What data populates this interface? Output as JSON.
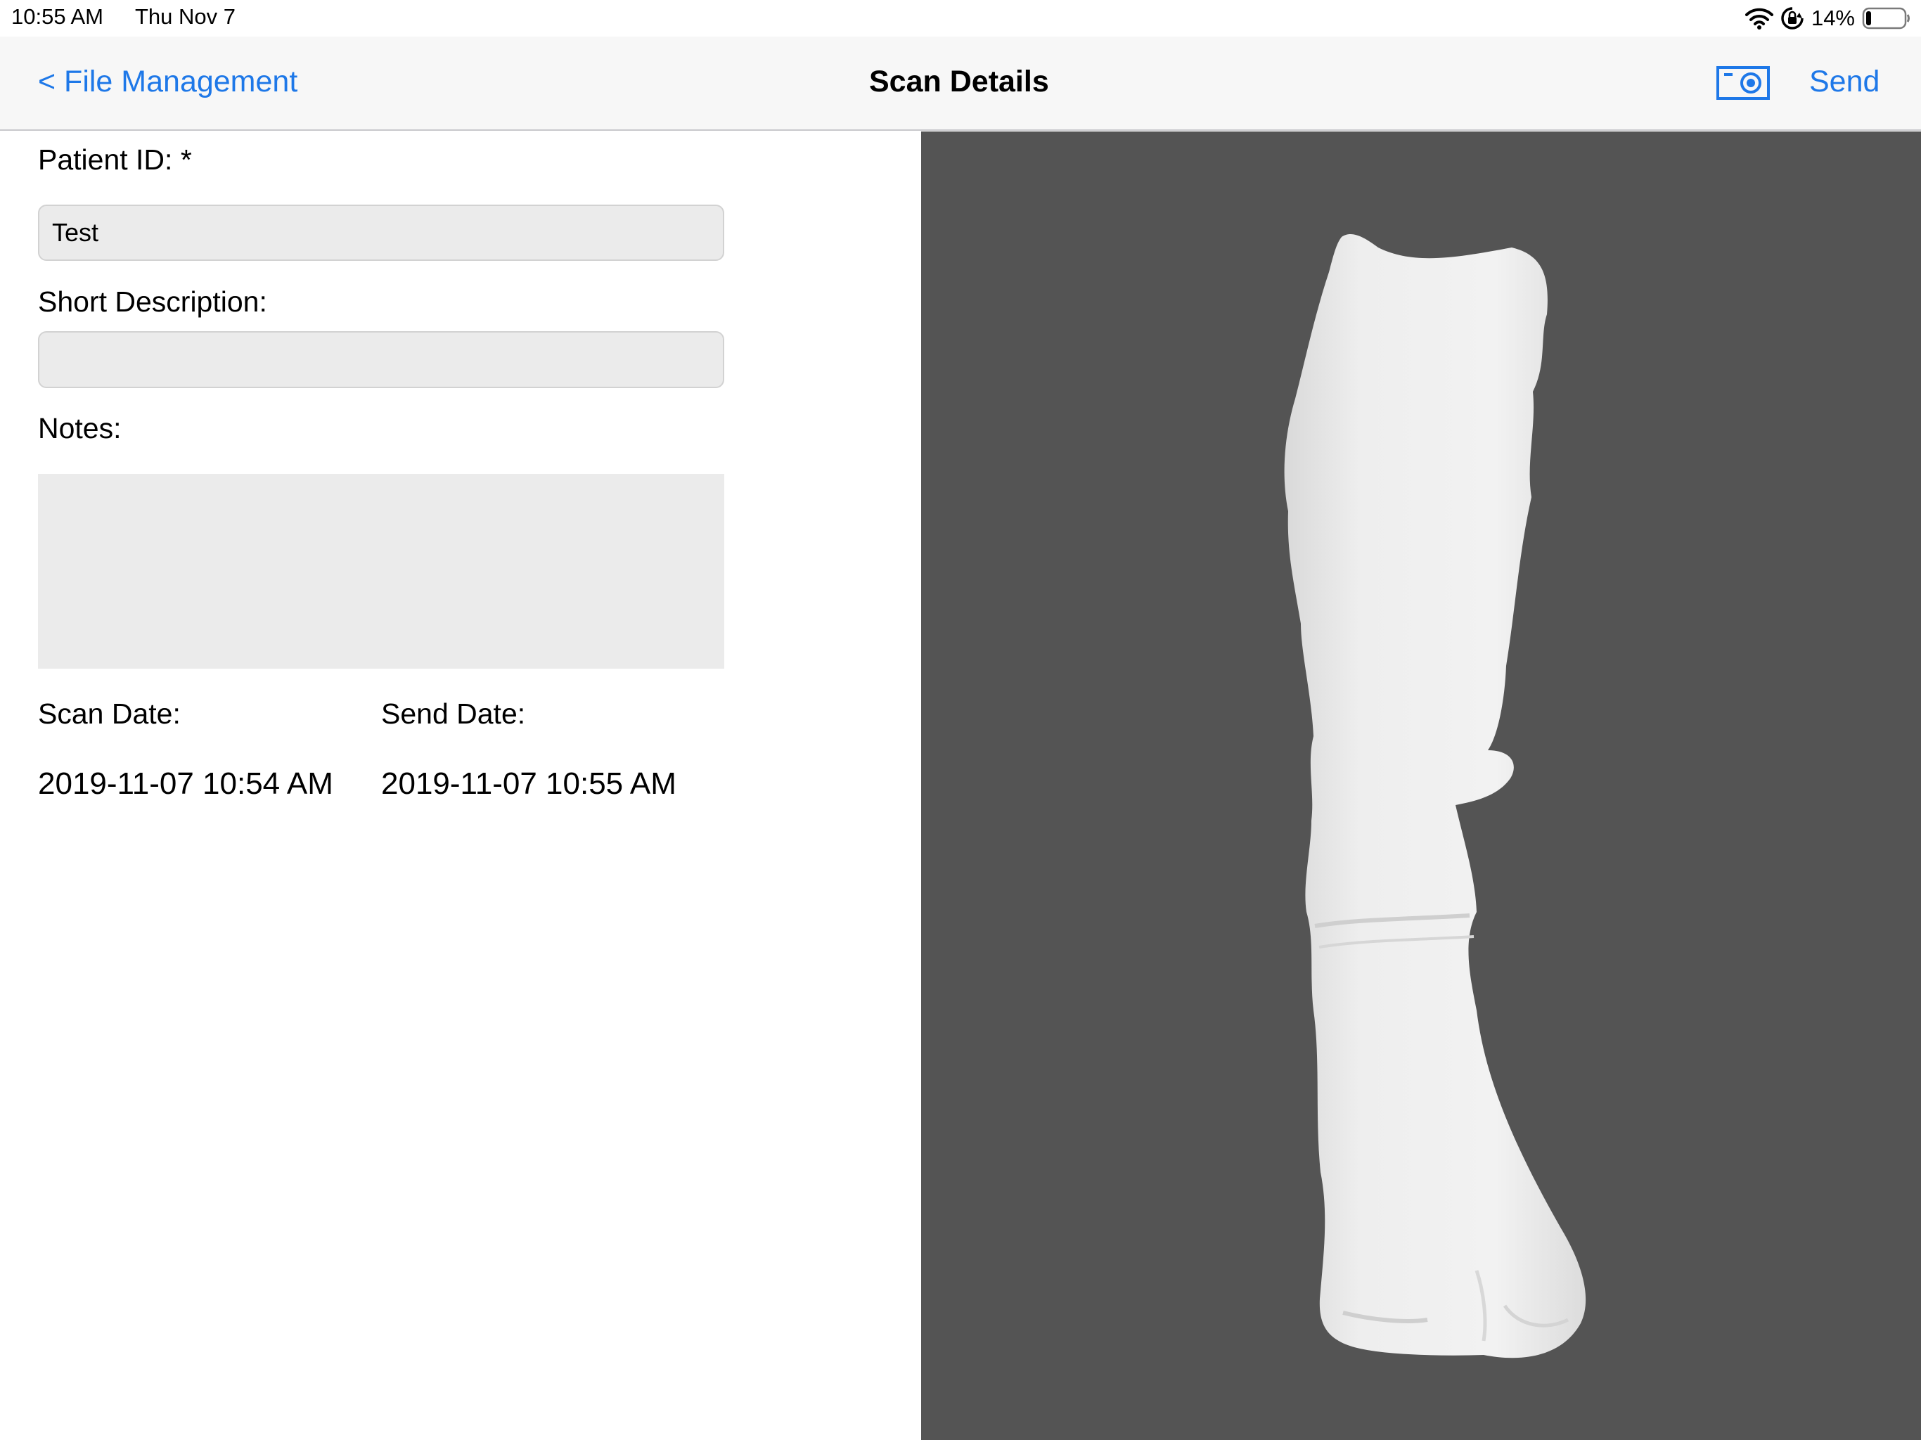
{
  "status_bar": {
    "time": "10:55 AM",
    "date": "Thu Nov 7",
    "battery_percent": "14%",
    "icons": [
      "wifi-icon",
      "orientation-lock-icon",
      "battery-icon"
    ],
    "battery_level": 0.14
  },
  "nav": {
    "back_label": "< File Management",
    "title": "Scan Details",
    "camera_icon": "camera-icon",
    "send_label": "Send"
  },
  "form": {
    "patient_id": {
      "label": "Patient ID: *",
      "value": "Test"
    },
    "short_description": {
      "label": "Short Description:",
      "value": ""
    },
    "notes": {
      "label": "Notes:",
      "value": ""
    },
    "scan_date": {
      "label": "Scan Date:",
      "value": "2019-11-07 10:54 AM"
    },
    "send_date": {
      "label": "Send Date:",
      "value": "2019-11-07 10:55 AM"
    }
  },
  "viewport": {
    "description_icon": "leg-scan-3d-model",
    "background_color": "#545454",
    "model_color": "#eeeeee"
  },
  "colors": {
    "accent": "#1e78e8",
    "nav_background": "#f7f7f7",
    "field_background": "#ebebeb"
  }
}
